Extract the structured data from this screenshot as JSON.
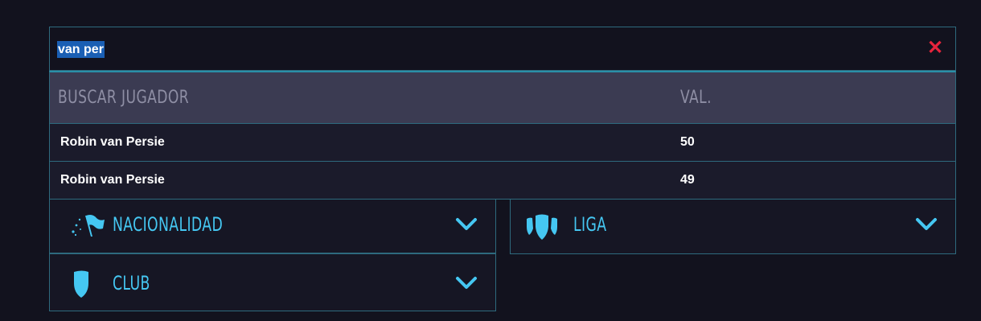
{
  "search": {
    "value": "van per",
    "clear_icon": "close-icon"
  },
  "results": {
    "header_player": "BUSCAR JUGADOR",
    "header_value": "VAL.",
    "rows": [
      {
        "name": "Robin van Persie",
        "value": "50"
      },
      {
        "name": "Robin van Persie",
        "value": "49"
      }
    ]
  },
  "filters": {
    "nationality": {
      "label": "NACIONALIDAD",
      "icon": "flag-stars-icon"
    },
    "league": {
      "label": "LIGA",
      "icon": "league-shield-icon"
    },
    "club": {
      "label": "CLUB",
      "icon": "club-shield-icon"
    }
  },
  "colors": {
    "background": "#12121e",
    "accent": "#45c7f2",
    "clear": "#e8243c",
    "header_bg": "#3b3b52",
    "selection": "#1a5fb4"
  }
}
